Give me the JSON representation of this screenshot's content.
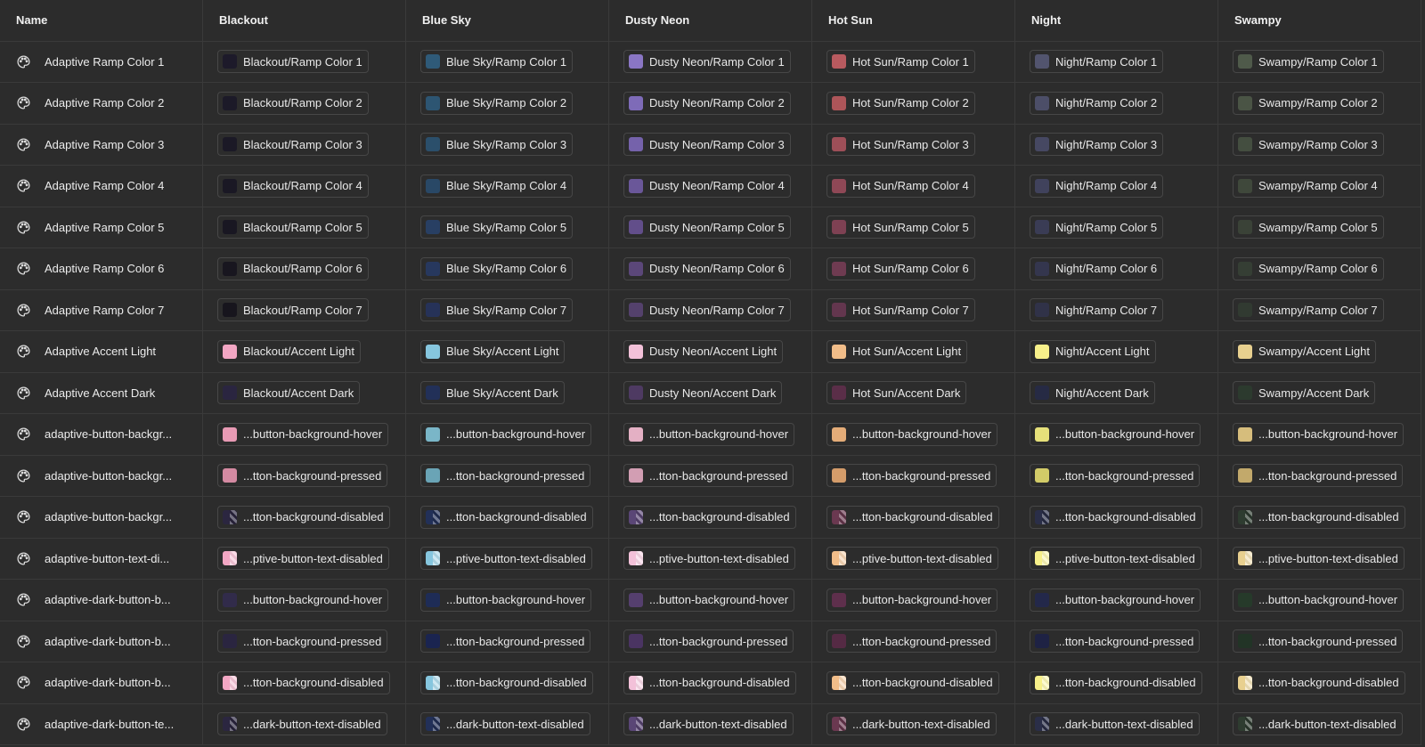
{
  "header": {
    "name": "Name",
    "themes": [
      "Blackout",
      "Blue Sky",
      "Dusty Neon",
      "Hot Sun",
      "Night",
      "Swampy"
    ]
  },
  "rows": [
    {
      "name": "Adaptive Ramp Color 1",
      "chips": [
        {
          "label": "Blackout/Ramp Color 1",
          "color": "#1d1a2a"
        },
        {
          "label": "Blue Sky/Ramp Color 1",
          "color": "#2f5a78"
        },
        {
          "label": "Dusty Neon/Ramp Color 1",
          "color": "#8a76c4"
        },
        {
          "label": "Hot Sun/Ramp Color 1",
          "color": "#b85a5f"
        },
        {
          "label": "Night/Ramp Color 1",
          "color": "#52546e"
        },
        {
          "label": "Swampy/Ramp Color 1",
          "color": "#4f5a4a"
        }
      ]
    },
    {
      "name": "Adaptive Ramp Color 2",
      "chips": [
        {
          "label": "Blackout/Ramp Color 2",
          "color": "#1c1a28"
        },
        {
          "label": "Blue Sky/Ramp Color 2",
          "color": "#2d5572"
        },
        {
          "label": "Dusty Neon/Ramp Color 2",
          "color": "#7e6bb8"
        },
        {
          "label": "Hot Sun/Ramp Color 2",
          "color": "#ad5559"
        },
        {
          "label": "Night/Ramp Color 2",
          "color": "#4c4e68"
        },
        {
          "label": "Swampy/Ramp Color 2",
          "color": "#4a5445"
        }
      ]
    },
    {
      "name": "Adaptive Ramp Color 3",
      "chips": [
        {
          "label": "Blackout/Ramp Color 3",
          "color": "#1b1926"
        },
        {
          "label": "Blue Sky/Ramp Color 3",
          "color": "#2b4f6b"
        },
        {
          "label": "Dusty Neon/Ramp Color 3",
          "color": "#7562ab"
        },
        {
          "label": "Hot Sun/Ramp Color 3",
          "color": "#9e4f58"
        },
        {
          "label": "Night/Ramp Color 3",
          "color": "#464862"
        },
        {
          "label": "Swampy/Ramp Color 3",
          "color": "#444e40"
        }
      ]
    },
    {
      "name": "Adaptive Ramp Color 4",
      "chips": [
        {
          "label": "Blackout/Ramp Color 4",
          "color": "#1a1824"
        },
        {
          "label": "Blue Sky/Ramp Color 4",
          "color": "#294866"
        },
        {
          "label": "Dusty Neon/Ramp Color 4",
          "color": "#6a5799"
        },
        {
          "label": "Hot Sun/Ramp Color 4",
          "color": "#8f4856"
        },
        {
          "label": "Night/Ramp Color 4",
          "color": "#40425c"
        },
        {
          "label": "Swampy/Ramp Color 4",
          "color": "#3f483b"
        }
      ]
    },
    {
      "name": "Adaptive Ramp Color 5",
      "chips": [
        {
          "label": "Blackout/Ramp Color 5",
          "color": "#191722"
        },
        {
          "label": "Blue Sky/Ramp Color 5",
          "color": "#283f63"
        },
        {
          "label": "Dusty Neon/Ramp Color 5",
          "color": "#624e8a"
        },
        {
          "label": "Hot Sun/Ramp Color 5",
          "color": "#7e4153"
        },
        {
          "label": "Night/Ramp Color 5",
          "color": "#3a3c55"
        },
        {
          "label": "Swampy/Ramp Color 5",
          "color": "#3a4237"
        }
      ]
    },
    {
      "name": "Adaptive Ramp Color 6",
      "chips": [
        {
          "label": "Blackout/Ramp Color 6",
          "color": "#18161f"
        },
        {
          "label": "Blue Sky/Ramp Color 6",
          "color": "#27385e"
        },
        {
          "label": "Dusty Neon/Ramp Color 6",
          "color": "#5b4779"
        },
        {
          "label": "Hot Sun/Ramp Color 6",
          "color": "#6f3b51"
        },
        {
          "label": "Night/Ramp Color 6",
          "color": "#34364e"
        },
        {
          "label": "Swampy/Ramp Color 6",
          "color": "#353e34"
        }
      ]
    },
    {
      "name": "Adaptive Ramp Color 7",
      "chips": [
        {
          "label": "Blackout/Ramp Color 7",
          "color": "#17151d"
        },
        {
          "label": "Blue Sky/Ramp Color 7",
          "color": "#263258"
        },
        {
          "label": "Dusty Neon/Ramp Color 7",
          "color": "#54416c"
        },
        {
          "label": "Hot Sun/Ramp Color 7",
          "color": "#63364e"
        },
        {
          "label": "Night/Ramp Color 7",
          "color": "#303248"
        },
        {
          "label": "Swampy/Ramp Color 7",
          "color": "#313a31"
        }
      ]
    },
    {
      "name": "Adaptive Accent Light",
      "chips": [
        {
          "label": "Blackout/Accent Light",
          "color": "#f2a6c3"
        },
        {
          "label": "Blue Sky/Accent Light",
          "color": "#86c6de"
        },
        {
          "label": "Dusty Neon/Accent Light",
          "color": "#f3c1d9"
        },
        {
          "label": "Hot Sun/Accent Light",
          "color": "#f1bd89"
        },
        {
          "label": "Night/Accent Light",
          "color": "#f7f08a"
        },
        {
          "label": "Swampy/Accent Light",
          "color": "#e8d08f"
        }
      ]
    },
    {
      "name": "Adaptive Accent Dark",
      "chips": [
        {
          "label": "Blackout/Accent Dark",
          "color": "#2a2540"
        },
        {
          "label": "Blue Sky/Accent Dark",
          "color": "#223058"
        },
        {
          "label": "Dusty Neon/Accent Dark",
          "color": "#4e3a62"
        },
        {
          "label": "Hot Sun/Accent Dark",
          "color": "#5a2e48"
        },
        {
          "label": "Night/Accent Dark",
          "color": "#262a44"
        },
        {
          "label": "Swampy/Accent Dark",
          "color": "#2c3a2e"
        }
      ]
    },
    {
      "name": "adaptive-button-backgr...",
      "chips": [
        {
          "label": "...button-background-hover",
          "color": "#e89ab4"
        },
        {
          "label": "...button-background-hover",
          "color": "#7ab6c8"
        },
        {
          "label": "...button-background-hover",
          "color": "#e4b0c4"
        },
        {
          "label": "...button-background-hover",
          "color": "#e4ac78"
        },
        {
          "label": "...button-background-hover",
          "color": "#e6e07a"
        },
        {
          "label": "...button-background-hover",
          "color": "#d6bd7c"
        }
      ]
    },
    {
      "name": "adaptive-button-backgr...",
      "chips": [
        {
          "label": "...tton-background-pressed",
          "color": "#d48aa2"
        },
        {
          "label": "...tton-background-pressed",
          "color": "#6aa4b6"
        },
        {
          "label": "...tton-background-pressed",
          "color": "#d29eb3"
        },
        {
          "label": "...tton-background-pressed",
          "color": "#d49c6a"
        },
        {
          "label": "...tton-background-pressed",
          "color": "#d2cb68"
        },
        {
          "label": "...tton-background-pressed",
          "color": "#c2a96b"
        }
      ]
    },
    {
      "name": "adaptive-button-backgr...",
      "chips": [
        {
          "label": "...tton-background-disabled",
          "color": "#2b2640",
          "pattern": "split"
        },
        {
          "label": "...tton-background-disabled",
          "color": "#223058",
          "pattern": "split"
        },
        {
          "label": "...tton-background-disabled",
          "color": "#5a4676",
          "pattern": "split"
        },
        {
          "label": "...tton-background-disabled",
          "color": "#6a3850",
          "pattern": "split"
        },
        {
          "label": "...tton-background-disabled",
          "color": "#2a2e48",
          "pattern": "split"
        },
        {
          "label": "...tton-background-disabled",
          "color": "#2e3c30",
          "pattern": "split"
        }
      ]
    },
    {
      "name": "adaptive-button-text-di...",
      "chips": [
        {
          "label": "...ptive-button-text-disabled",
          "color": "#f2a6c3",
          "pattern": "split-light"
        },
        {
          "label": "...ptive-button-text-disabled",
          "color": "#86c6de",
          "pattern": "split-light"
        },
        {
          "label": "...ptive-button-text-disabled",
          "color": "#f3c1d9",
          "pattern": "split-light"
        },
        {
          "label": "...ptive-button-text-disabled",
          "color": "#f1bd89",
          "pattern": "split-light"
        },
        {
          "label": "...ptive-button-text-disabled",
          "color": "#f7f08a",
          "pattern": "split-light"
        },
        {
          "label": "...ptive-button-text-disabled",
          "color": "#e8d08f",
          "pattern": "split-light"
        }
      ]
    },
    {
      "name": "adaptive-dark-button-b...",
      "chips": [
        {
          "label": "...button-background-hover",
          "color": "#312b4a"
        },
        {
          "label": "...button-background-hover",
          "color": "#1e2c56"
        },
        {
          "label": "...button-background-hover",
          "color": "#553f6e"
        },
        {
          "label": "...button-background-hover",
          "color": "#5e2f4c"
        },
        {
          "label": "...button-background-hover",
          "color": "#23284a"
        },
        {
          "label": "...button-background-hover",
          "color": "#263a2a"
        }
      ]
    },
    {
      "name": "adaptive-dark-button-b...",
      "chips": [
        {
          "label": "...tton-background-pressed",
          "color": "#2a2540"
        },
        {
          "label": "...tton-background-pressed",
          "color": "#1a2450"
        },
        {
          "label": "...tton-background-pressed",
          "color": "#4a3462"
        },
        {
          "label": "...tton-background-pressed",
          "color": "#552a44"
        },
        {
          "label": "...tton-background-pressed",
          "color": "#1e2244"
        },
        {
          "label": "...tton-background-pressed",
          "color": "#223426"
        }
      ]
    },
    {
      "name": "adaptive-dark-button-b...",
      "chips": [
        {
          "label": "...tton-background-disabled",
          "color": "#f2a6c3",
          "pattern": "split-light"
        },
        {
          "label": "...tton-background-disabled",
          "color": "#86c6de",
          "pattern": "split-light"
        },
        {
          "label": "...tton-background-disabled",
          "color": "#f3c1d9",
          "pattern": "split-light"
        },
        {
          "label": "...tton-background-disabled",
          "color": "#f1bd89",
          "pattern": "split-light"
        },
        {
          "label": "...tton-background-disabled",
          "color": "#f7f08a",
          "pattern": "split-light"
        },
        {
          "label": "...tton-background-disabled",
          "color": "#e8d08f",
          "pattern": "split-light"
        }
      ]
    },
    {
      "name": "adaptive-dark-button-te...",
      "chips": [
        {
          "label": "...dark-button-text-disabled",
          "color": "#2b2640",
          "pattern": "split"
        },
        {
          "label": "...dark-button-text-disabled",
          "color": "#223058",
          "pattern": "split"
        },
        {
          "label": "...dark-button-text-disabled",
          "color": "#5a4676",
          "pattern": "split"
        },
        {
          "label": "...dark-button-text-disabled",
          "color": "#6a3850",
          "pattern": "split"
        },
        {
          "label": "...dark-button-text-disabled",
          "color": "#2a2e48",
          "pattern": "split"
        },
        {
          "label": "...dark-button-text-disabled",
          "color": "#2e3c30",
          "pattern": "split"
        }
      ]
    }
  ]
}
